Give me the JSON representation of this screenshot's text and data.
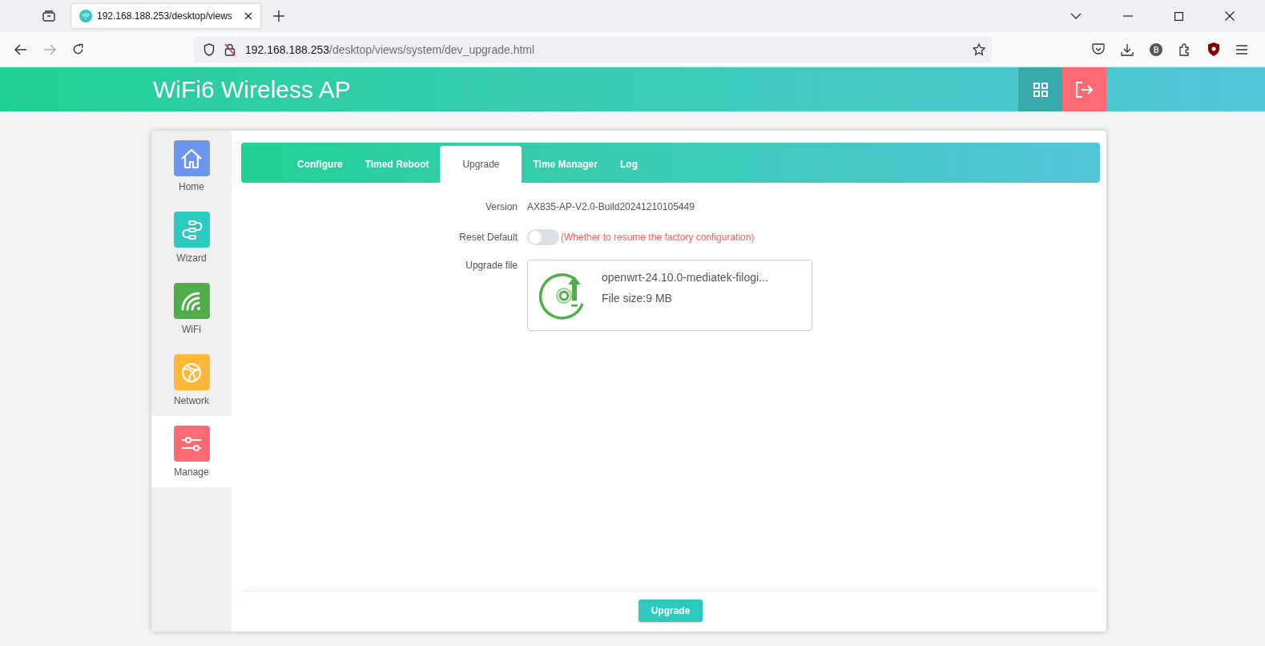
{
  "browser": {
    "tab_title": "192.168.188.253/desktop/views",
    "url_host": "192.168.188.253",
    "url_path": "/desktop/views/system/dev_upgrade.html"
  },
  "header": {
    "title": "WiFi6 Wireless AP"
  },
  "sidebar": {
    "items": [
      {
        "label": "Home",
        "kind": "home",
        "selected": false
      },
      {
        "label": "Wizard",
        "kind": "wizard",
        "selected": false
      },
      {
        "label": "WiFi",
        "kind": "wifi",
        "selected": false
      },
      {
        "label": "Network",
        "kind": "network",
        "selected": false
      },
      {
        "label": "Manage",
        "kind": "manage",
        "selected": true
      }
    ]
  },
  "tabs": [
    {
      "label": "Configure",
      "selected": false
    },
    {
      "label": "Timed Reboot",
      "selected": false
    },
    {
      "label": "Upgrade",
      "selected": true
    },
    {
      "label": "Time Manager",
      "selected": false
    },
    {
      "label": "Log",
      "selected": false
    }
  ],
  "form": {
    "version_label": "Version",
    "version_value": "AX835-AP-V2.0-Build20241210105449",
    "reset_label": "Reset Default",
    "reset_on": false,
    "reset_hint": "(Whether to resume the factory configuration)",
    "file_label": "Upgrade file",
    "file_name": "openwrt-24.10.0-mediatek-filogi...",
    "file_size": "File size:9 MB"
  },
  "upgrade_button": "Upgrade"
}
